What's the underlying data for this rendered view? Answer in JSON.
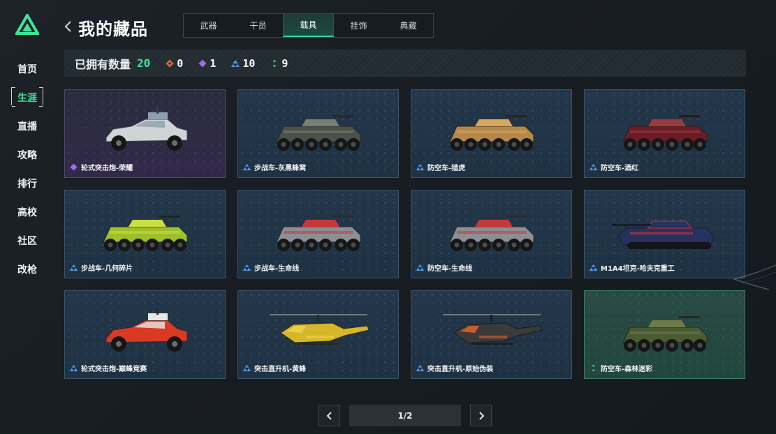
{
  "sidebar": {
    "items": [
      {
        "label": "首页",
        "active": false
      },
      {
        "label": "生涯",
        "active": true
      },
      {
        "label": "直播",
        "active": false
      },
      {
        "label": "攻略",
        "active": false
      },
      {
        "label": "排行",
        "active": false
      },
      {
        "label": "高校",
        "active": false
      },
      {
        "label": "社区",
        "active": false
      },
      {
        "label": "改枪",
        "active": false
      }
    ]
  },
  "header": {
    "title": "我的藏品",
    "tabs": [
      {
        "label": "武器",
        "active": false
      },
      {
        "label": "干员",
        "active": false
      },
      {
        "label": "载具",
        "active": true
      },
      {
        "label": "挂饰",
        "active": false
      },
      {
        "label": "典藏",
        "active": false
      }
    ]
  },
  "stats": {
    "label": "已拥有数量",
    "total": "20",
    "items": [
      {
        "icon": "orange-diamond-icon",
        "color": "#e0693a",
        "count": "0"
      },
      {
        "icon": "purple-diamond-icon",
        "color": "#9b6ee0",
        "count": "1"
      },
      {
        "icon": "blue-triangle-icon",
        "color": "#4f9be6",
        "count": "10"
      },
      {
        "icon": "green-dots-icon",
        "color": "#3ee39a",
        "count": "9"
      }
    ]
  },
  "colors": {
    "accent": "#3ee39a",
    "rarity_purple": "#9b6ee0",
    "rarity_blue": "#4f9be6",
    "rarity_green": "#3ee39a"
  },
  "vehicles": [
    {
      "name": "轮式突击炮-荣耀",
      "rarity": "purple",
      "kind": "buggy",
      "palette": [
        "#cfd4d6",
        "#3a3f45",
        "#8fa0ab"
      ]
    },
    {
      "name": "步战车-灰黑蜂窝",
      "rarity": "blue",
      "kind": "apc",
      "palette": [
        "#4c5048",
        "#25282a",
        "#7a7e74"
      ]
    },
    {
      "name": "防空车-猎虎",
      "rarity": "blue",
      "kind": "apc",
      "palette": [
        "#b5884a",
        "#2a231c",
        "#d8a760"
      ]
    },
    {
      "name": "防空车-酒红",
      "rarity": "blue",
      "kind": "apc",
      "palette": [
        "#6b1d26",
        "#2a1a1c",
        "#9a3a40"
      ]
    },
    {
      "name": "步战车-几何碎片",
      "rarity": "blue",
      "kind": "apc",
      "palette": [
        "#9fbf2a",
        "#1f2618",
        "#c8e040"
      ]
    },
    {
      "name": "步战车-生命线",
      "rarity": "blue",
      "kind": "apc",
      "palette": [
        "#8c8f94",
        "#2a2c30",
        "#c43a3a"
      ]
    },
    {
      "name": "防空车-生命线",
      "rarity": "blue",
      "kind": "apc",
      "palette": [
        "#8c8f94",
        "#2a2c30",
        "#c43a3a"
      ]
    },
    {
      "name": "M1A4坦克-哈夫克重工",
      "rarity": "blue",
      "kind": "tank",
      "palette": [
        "#25325e",
        "#1a1d2a",
        "#9a3040"
      ]
    },
    {
      "name": "轮式突击炮-巅峰竞赛",
      "rarity": "blue",
      "kind": "buggy",
      "palette": [
        "#d83a22",
        "#2a2a2a",
        "#e8e8e8"
      ]
    },
    {
      "name": "突击直升机-黄蜂",
      "rarity": "blue",
      "kind": "heli",
      "palette": [
        "#d6b62a",
        "#2a2718",
        "#f0d04a"
      ]
    },
    {
      "name": "突击直升机-原始伪装",
      "rarity": "blue",
      "kind": "heli",
      "palette": [
        "#3a3a3a",
        "#1a1a1a",
        "#d0642a"
      ]
    },
    {
      "name": "防空车-森林迷彩",
      "rarity": "green",
      "kind": "apc",
      "palette": [
        "#4a5a32",
        "#242a1c",
        "#6e7a48"
      ]
    }
  ],
  "pager": {
    "page_text": "1/2",
    "prev_icon": "chevron-left-icon",
    "next_icon": "chevron-right-icon"
  }
}
